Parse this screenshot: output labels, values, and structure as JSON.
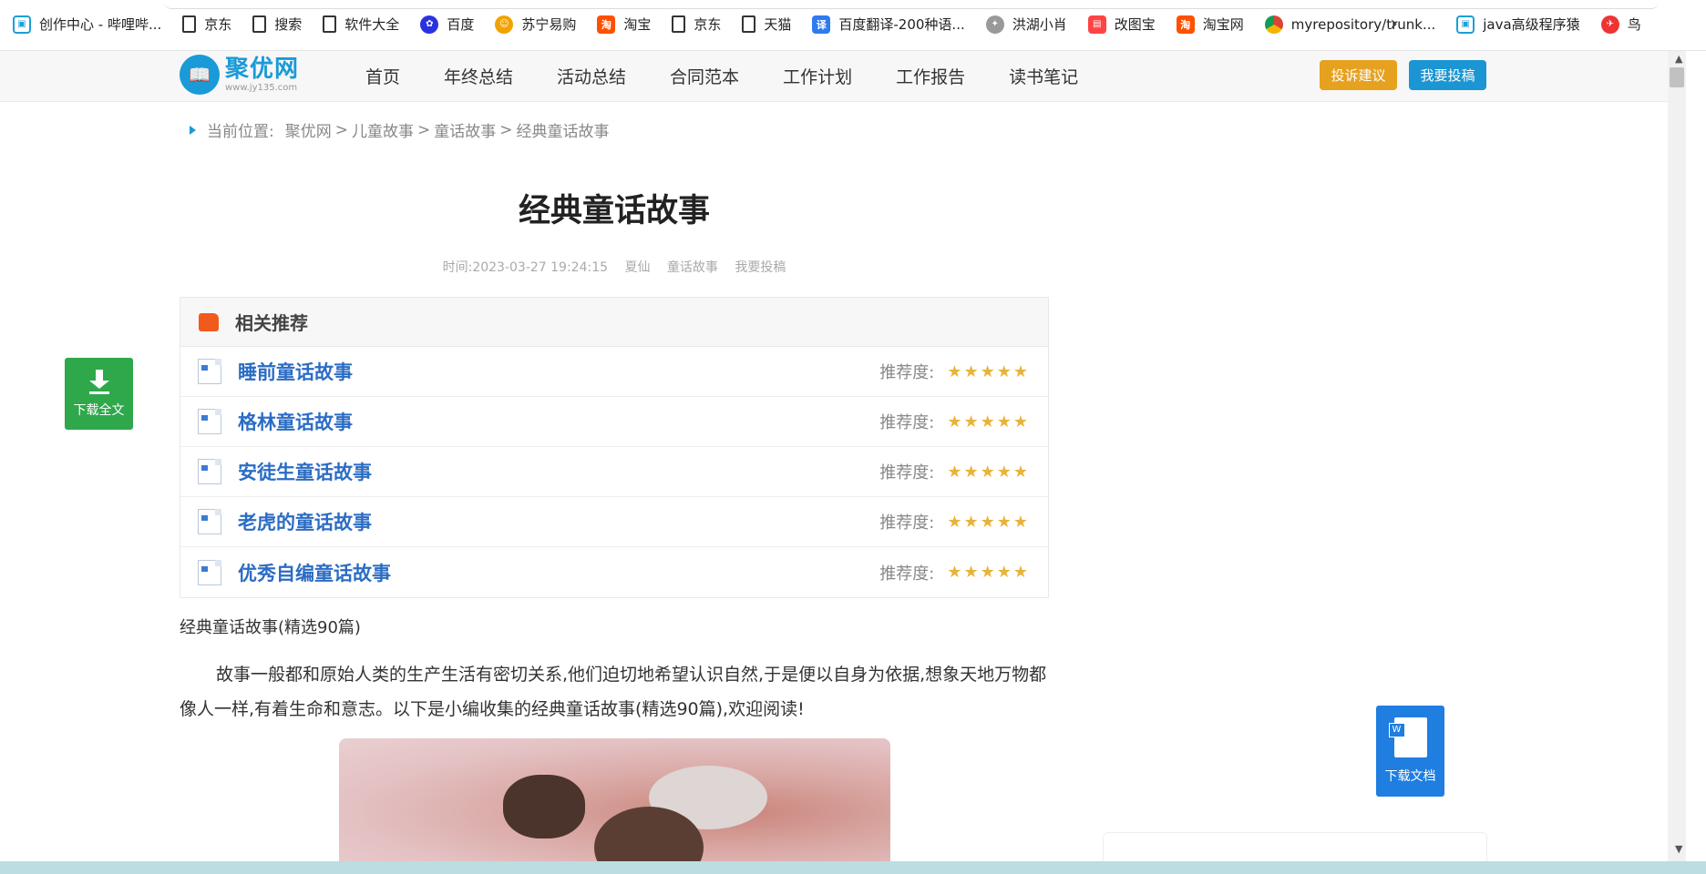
{
  "bookmarks": [
    {
      "label": "创作中心 - 哔哩哔...",
      "icon": "bilibili-icon"
    },
    {
      "label": "京东",
      "icon": "document-icon"
    },
    {
      "label": "搜索",
      "icon": "document-icon"
    },
    {
      "label": "软件大全",
      "icon": "document-icon"
    },
    {
      "label": "百度",
      "icon": "baidu-icon"
    },
    {
      "label": "苏宁易购",
      "icon": "suning-icon"
    },
    {
      "label": "淘宝",
      "icon": "taobao-icon"
    },
    {
      "label": "京东",
      "icon": "document-icon"
    },
    {
      "label": "天猫",
      "icon": "document-icon"
    },
    {
      "label": "百度翻译-200种语...",
      "icon": "translate-icon"
    },
    {
      "label": "洪湖小肖",
      "icon": "bird-icon"
    },
    {
      "label": "改图宝",
      "icon": "gaitubao-icon"
    },
    {
      "label": "淘宝网",
      "icon": "taobao-icon"
    },
    {
      "label": "myrepository/trunk...",
      "icon": "chrome-icon"
    },
    {
      "label": "java高级程序猿",
      "icon": "bilibili-icon"
    },
    {
      "label": "鸟",
      "icon": "bird-icon"
    }
  ],
  "site": {
    "logo_main": "聚优网",
    "logo_sub": "www.jy135.com",
    "nav": [
      "首页",
      "年终总结",
      "活动总结",
      "合同范本",
      "工作计划",
      "工作报告",
      "读书笔记"
    ],
    "btn_complain": "投诉建议",
    "btn_submit": "我要投稿"
  },
  "breadcrumb": {
    "prefix": "当前位置:",
    "items": [
      "聚优网",
      "儿童故事",
      "童话故事",
      "经典童话故事"
    ]
  },
  "article": {
    "title": "经典童话故事",
    "meta_time": "时间:2023-03-27 19:24:15",
    "meta_author": "夏仙",
    "meta_category": "童话故事",
    "meta_submit": "我要投稿",
    "subheading": "经典童话故事(精选90篇)",
    "paragraph": "故事一般都和原始人类的生产生活有密切关系,他们迫切地希望认识自然,于是便以自身为依据,想象天地万物都像人一样,有着生命和意志。以下是小编收集的经典童话故事(精选90篇),欢迎阅读!"
  },
  "recommend": {
    "heading": "相关推荐",
    "score_label": "推荐度:",
    "stars": "★★★★★",
    "items": [
      "睡前童话故事",
      "格林童话故事",
      "安徒生童话故事",
      "老虎的童话故事",
      "优秀自编童话故事"
    ]
  },
  "floating": {
    "download_full": "下载全文",
    "download_doc": "下载文档"
  },
  "colors": {
    "brand": "#1a9ad6",
    "complain": "#e6a11f",
    "submit": "#1b95d3",
    "link": "#2b6cc4",
    "star": "#e8b33a",
    "download_full_bg": "#2ea84b",
    "download_doc_bg": "#1f7ee0"
  }
}
